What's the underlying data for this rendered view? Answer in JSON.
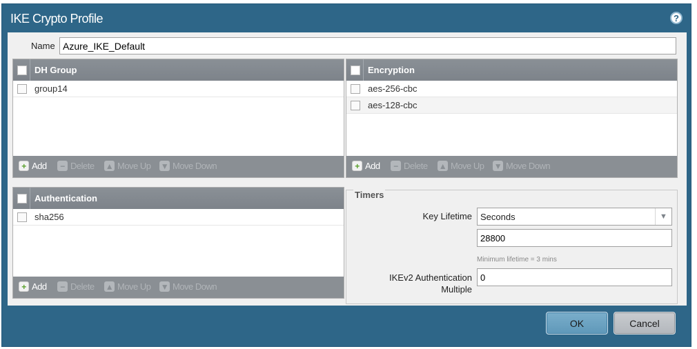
{
  "dialog": {
    "title": "IKE Crypto Profile",
    "help_icon": "?"
  },
  "name": {
    "label": "Name",
    "value": "Azure_IKE_Default"
  },
  "dh_group": {
    "header": "DH Group",
    "items": [
      {
        "label": "group14"
      }
    ]
  },
  "encryption": {
    "header": "Encryption",
    "items": [
      {
        "label": "aes-256-cbc"
      },
      {
        "label": "aes-128-cbc"
      }
    ]
  },
  "authentication": {
    "header": "Authentication",
    "items": [
      {
        "label": "sha256"
      }
    ]
  },
  "toolbar": {
    "add": "Add",
    "delete": "Delete",
    "move_up": "Move Up",
    "move_down": "Move Down"
  },
  "timers": {
    "title": "Timers",
    "key_lifetime_label": "Key Lifetime",
    "key_lifetime_unit": "Seconds",
    "key_lifetime_value": "28800",
    "hint": "Minimum lifetime = 3 mins",
    "ikev2_label_line1": "IKEv2 Authentication",
    "ikev2_label_line2": "Multiple",
    "ikev2_value": "0"
  },
  "buttons": {
    "ok": "OK",
    "cancel": "Cancel"
  },
  "colors": {
    "dialog_bg": "#2e6688",
    "header_bg": "#8a9096",
    "add_icon": "#5aa02c"
  }
}
